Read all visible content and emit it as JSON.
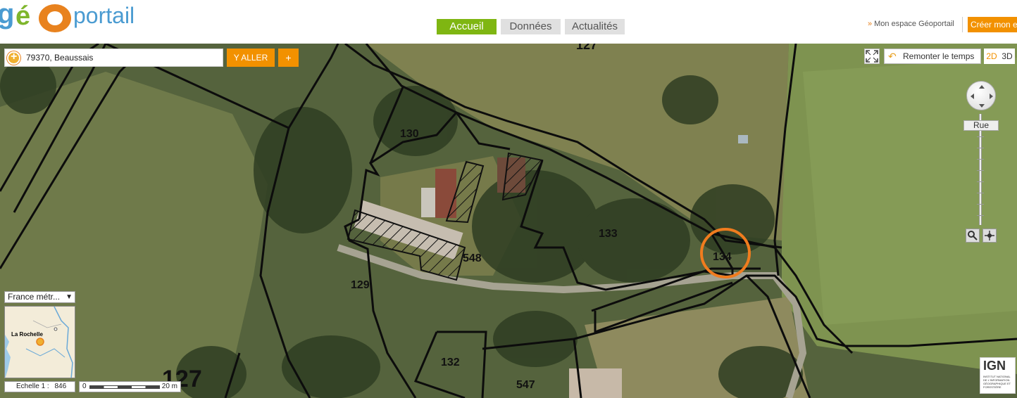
{
  "header": {
    "logo_geo": "géo",
    "logo_portail": "portail",
    "tabs": [
      {
        "label": "Accueil",
        "active": true
      },
      {
        "label": "Données",
        "active": false
      },
      {
        "label": "Actualités",
        "active": false
      }
    ],
    "espace_link": "Mon espace Géoportail",
    "create_button": "Créer mon espace"
  },
  "search": {
    "value": "79370, Beaussais",
    "go_label": "Y ALLER",
    "plus_label": "+"
  },
  "controls": {
    "remonter_label": "Remonter le temps",
    "dim_2d": "2D",
    "dim_3d": "3D",
    "zoom_level_label": "Rue"
  },
  "minimap": {
    "territory": "France métr...",
    "city": "La Rochelle"
  },
  "scale": {
    "echelle_label": "Echelle 1 :",
    "echelle_value": "846",
    "bar_start": "0",
    "bar_end": "20 m"
  },
  "parcels": [
    "127",
    "130",
    "133",
    "134",
    "548",
    "129",
    "132",
    "547",
    "127"
  ],
  "ign": {
    "name": "IGN",
    "subtitle": "INSTITUT NATIONAL DE L'INFORMATION GÉOGRAPHIQUE ET FORESTIÈRE"
  },
  "colors": {
    "brand_orange": "#f29100",
    "brand_green": "#7fb612",
    "highlight_circle": "#f07c1e"
  }
}
